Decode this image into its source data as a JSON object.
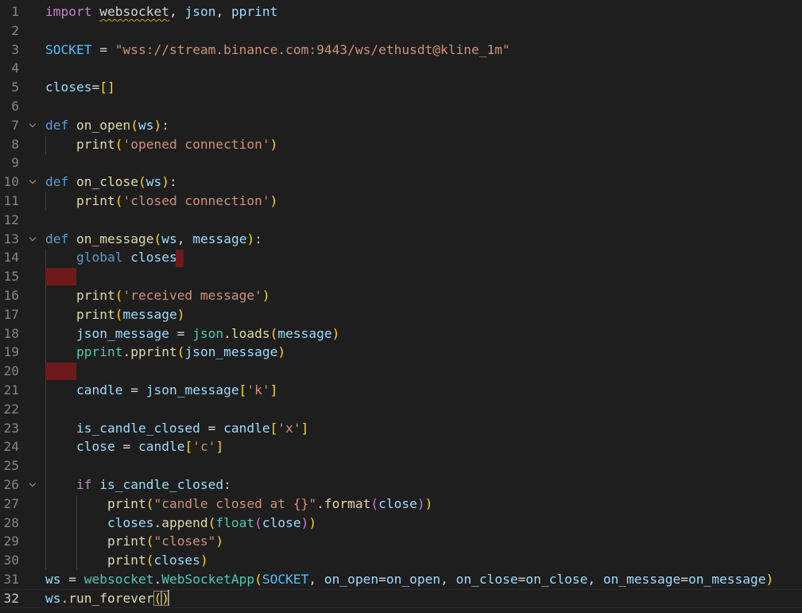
{
  "editor": {
    "language": "python",
    "current_line": 32,
    "lines": [
      {
        "n": "1",
        "t": [
          [
            "import",
            "kw-purple"
          ],
          [
            " ",
            ""
          ],
          [
            "websocket",
            "squig"
          ],
          [
            ", ",
            ""
          ],
          [
            "json",
            "var"
          ],
          [
            ", ",
            ""
          ],
          [
            "pprint",
            "var"
          ]
        ]
      },
      {
        "n": "2",
        "t": []
      },
      {
        "n": "3",
        "t": [
          [
            "SOCKET",
            "const"
          ],
          [
            " = ",
            ""
          ],
          [
            "\"wss://stream.binance.com:9443/ws/ethusdt@kline_1m\"",
            "str"
          ]
        ]
      },
      {
        "n": "4",
        "t": []
      },
      {
        "n": "5",
        "t": [
          [
            "closes",
            "var"
          ],
          [
            "=",
            ""
          ],
          [
            "[]",
            "b1"
          ]
        ]
      },
      {
        "n": "6",
        "t": []
      },
      {
        "n": "7",
        "fold": true,
        "t": [
          [
            "def",
            "kw-blue"
          ],
          [
            " ",
            ""
          ],
          [
            "on_open",
            "fn"
          ],
          [
            "(",
            "b1"
          ],
          [
            "ws",
            "var"
          ],
          [
            ")",
            "b1"
          ],
          [
            ":",
            ""
          ]
        ]
      },
      {
        "n": "8",
        "t": [
          [
            "    ",
            ""
          ],
          [
            "print",
            "fn"
          ],
          [
            "(",
            "b1"
          ],
          [
            "'opened connection'",
            "str"
          ],
          [
            ")",
            "b1"
          ]
        ]
      },
      {
        "n": "9",
        "t": []
      },
      {
        "n": "10",
        "fold": true,
        "t": [
          [
            "def",
            "kw-blue"
          ],
          [
            " ",
            ""
          ],
          [
            "on_close",
            "fn"
          ],
          [
            "(",
            "b1"
          ],
          [
            "ws",
            "var"
          ],
          [
            ")",
            "b1"
          ],
          [
            ":",
            ""
          ]
        ]
      },
      {
        "n": "11",
        "t": [
          [
            "    ",
            ""
          ],
          [
            "print",
            "fn"
          ],
          [
            "(",
            "b1"
          ],
          [
            "'closed connection'",
            "str"
          ],
          [
            ")",
            "b1"
          ]
        ]
      },
      {
        "n": "12",
        "t": []
      },
      {
        "n": "13",
        "fold": true,
        "t": [
          [
            "def",
            "kw-blue"
          ],
          [
            " ",
            ""
          ],
          [
            "on_message",
            "fn"
          ],
          [
            "(",
            "b1"
          ],
          [
            "ws",
            "var"
          ],
          [
            ", ",
            ""
          ],
          [
            "message",
            "var"
          ],
          [
            ")",
            "b1"
          ],
          [
            ":",
            ""
          ]
        ]
      },
      {
        "n": "14",
        "t": [
          [
            "    ",
            ""
          ],
          [
            "global",
            "kw-blue"
          ],
          [
            " ",
            ""
          ],
          [
            "closes",
            "var"
          ]
        ]
      },
      {
        "n": "15",
        "t": []
      },
      {
        "n": "16",
        "t": [
          [
            "    ",
            ""
          ],
          [
            "print",
            "fn"
          ],
          [
            "(",
            "b1"
          ],
          [
            "'received message'",
            "str"
          ],
          [
            ")",
            "b1"
          ]
        ]
      },
      {
        "n": "17",
        "t": [
          [
            "    ",
            ""
          ],
          [
            "print",
            "fn"
          ],
          [
            "(",
            "b1"
          ],
          [
            "message",
            "var"
          ],
          [
            ")",
            "b1"
          ]
        ]
      },
      {
        "n": "18",
        "t": [
          [
            "    ",
            ""
          ],
          [
            "json_message",
            "var"
          ],
          [
            " = ",
            ""
          ],
          [
            "json",
            "cls"
          ],
          [
            ".",
            ""
          ],
          [
            "loads",
            "fn"
          ],
          [
            "(",
            "b1"
          ],
          [
            "message",
            "var"
          ],
          [
            ")",
            "b1"
          ]
        ]
      },
      {
        "n": "19",
        "t": [
          [
            "    ",
            ""
          ],
          [
            "pprint",
            "cls"
          ],
          [
            ".",
            ""
          ],
          [
            "pprint",
            "fn"
          ],
          [
            "(",
            "b1"
          ],
          [
            "json_message",
            "var"
          ],
          [
            ")",
            "b1"
          ]
        ]
      },
      {
        "n": "20",
        "t": []
      },
      {
        "n": "21",
        "t": [
          [
            "    ",
            ""
          ],
          [
            "candle",
            "var"
          ],
          [
            " = ",
            ""
          ],
          [
            "json_message",
            "var"
          ],
          [
            "[",
            "b1"
          ],
          [
            "'k'",
            "str"
          ],
          [
            "]",
            "b1"
          ]
        ]
      },
      {
        "n": "22",
        "t": []
      },
      {
        "n": "23",
        "t": [
          [
            "    ",
            ""
          ],
          [
            "is_candle_closed",
            "var"
          ],
          [
            " = ",
            ""
          ],
          [
            "candle",
            "var"
          ],
          [
            "[",
            "b1"
          ],
          [
            "'x'",
            "str"
          ],
          [
            "]",
            "b1"
          ]
        ]
      },
      {
        "n": "24",
        "t": [
          [
            "    ",
            ""
          ],
          [
            "close",
            "var"
          ],
          [
            " = ",
            ""
          ],
          [
            "candle",
            "var"
          ],
          [
            "[",
            "b1"
          ],
          [
            "'c'",
            "str"
          ],
          [
            "]",
            "b1"
          ]
        ]
      },
      {
        "n": "25",
        "t": []
      },
      {
        "n": "26",
        "fold": true,
        "t": [
          [
            "    ",
            ""
          ],
          [
            "if",
            "kw-purple"
          ],
          [
            " ",
            ""
          ],
          [
            "is_candle_closed",
            "var"
          ],
          [
            ":",
            ""
          ]
        ]
      },
      {
        "n": "27",
        "t": [
          [
            "        ",
            ""
          ],
          [
            "print",
            "fn"
          ],
          [
            "(",
            "b1"
          ],
          [
            "\"candle closed at {}\"",
            "str"
          ],
          [
            ".",
            ""
          ],
          [
            "format",
            "fn"
          ],
          [
            "(",
            "b2"
          ],
          [
            "close",
            "var"
          ],
          [
            ")",
            "b2"
          ],
          [
            ")",
            "b1"
          ]
        ]
      },
      {
        "n": "28",
        "t": [
          [
            "        ",
            ""
          ],
          [
            "closes",
            "var"
          ],
          [
            ".",
            ""
          ],
          [
            "append",
            "fn"
          ],
          [
            "(",
            "b1"
          ],
          [
            "float",
            "cls"
          ],
          [
            "(",
            "b2"
          ],
          [
            "close",
            "var"
          ],
          [
            ")",
            "b2"
          ],
          [
            ")",
            "b1"
          ]
        ]
      },
      {
        "n": "29",
        "t": [
          [
            "        ",
            ""
          ],
          [
            "print",
            "fn"
          ],
          [
            "(",
            "b1"
          ],
          [
            "\"closes\"",
            "str"
          ],
          [
            ")",
            "b1"
          ]
        ]
      },
      {
        "n": "30",
        "t": [
          [
            "        ",
            ""
          ],
          [
            "print",
            "fn"
          ],
          [
            "(",
            "b1"
          ],
          [
            "closes",
            "var"
          ],
          [
            ")",
            "b1"
          ]
        ]
      },
      {
        "n": "31",
        "t": [
          [
            "ws",
            "var"
          ],
          [
            " = ",
            ""
          ],
          [
            "websocket",
            "cls"
          ],
          [
            ".",
            ""
          ],
          [
            "WebSocketApp",
            "cls"
          ],
          [
            "(",
            "b1"
          ],
          [
            "SOCKET",
            "const"
          ],
          [
            ", ",
            ""
          ],
          [
            "on_open",
            "var"
          ],
          [
            "=",
            ""
          ],
          [
            "on_open",
            "var"
          ],
          [
            ", ",
            ""
          ],
          [
            "on_close",
            "var"
          ],
          [
            "=",
            ""
          ],
          [
            "on_close",
            "var"
          ],
          [
            ", ",
            ""
          ],
          [
            "on_message",
            "var"
          ],
          [
            "=",
            ""
          ],
          [
            "on_message",
            "var"
          ],
          [
            ")",
            "b1"
          ]
        ]
      },
      {
        "n": "32",
        "t": [
          [
            "ws",
            "var"
          ],
          [
            ".",
            ""
          ],
          [
            "run_forever",
            "fn"
          ],
          [
            "(",
            "b1 match"
          ],
          [
            ")",
            "b1 match"
          ]
        ]
      }
    ]
  }
}
